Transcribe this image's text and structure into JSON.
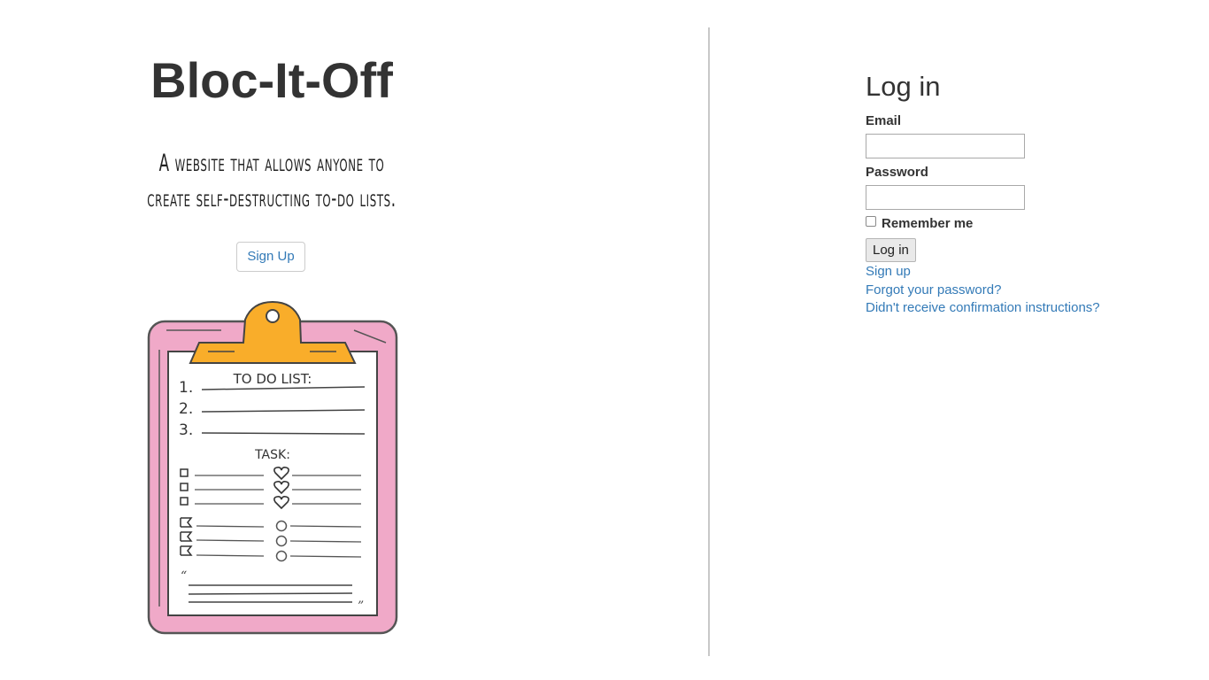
{
  "brand": {
    "title": "Bloc-It-Off",
    "tagline_line1": "A website that allows anyone to",
    "tagline_line2": "create self-destructing to-do lists.",
    "signup_button": "Sign Up"
  },
  "illustration": {
    "name": "clipboard-illustration",
    "heading": "TO DO LIST:",
    "numbers": [
      "1.",
      "2.",
      "3."
    ],
    "task_heading": "TASK:",
    "colors": {
      "board": "#f0a9c8",
      "clip": "#f9ad2a",
      "ink": "#3a3a3a"
    }
  },
  "login": {
    "heading": "Log in",
    "email_label": "Email",
    "email_value": "",
    "password_label": "Password",
    "password_value": "",
    "remember_label": "Remember me",
    "remember_checked": false,
    "submit_label": "Log in",
    "links": {
      "sign_up": "Sign up",
      "forgot_password": "Forgot your password?",
      "confirmation": "Didn't receive confirmation instructions?"
    },
    "link_color": "#337ab7"
  }
}
